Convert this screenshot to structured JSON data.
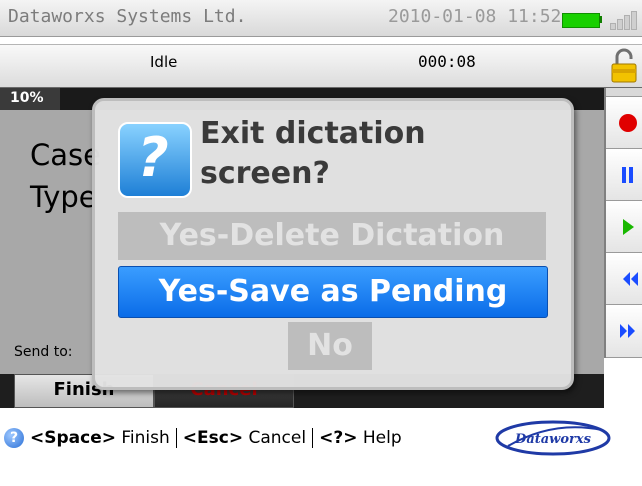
{
  "statusbar": {
    "company": "Dataworxs Systems Ltd.",
    "datetime": "2010-01-08 11:52",
    "colors": {
      "battery": "#19d000"
    }
  },
  "recorder": {
    "state": "Idle",
    "timer": "000:08",
    "progress_text": "10%",
    "progress_fraction": 0.1
  },
  "main": {
    "case_label": "Case",
    "type_label": "Type",
    "send_to_label": "Send to:"
  },
  "controls": [
    {
      "icon": "record-icon",
      "color": "#e00000"
    },
    {
      "icon": "pause-icon",
      "color": "#1a4cff"
    },
    {
      "icon": "play-icon",
      "color": "#19b800"
    },
    {
      "icon": "rewind-icon",
      "color": "#1a4cff"
    },
    {
      "icon": "fast-forward-icon",
      "color": "#1a4cff"
    }
  ],
  "tabs": {
    "finish": "Finish",
    "cancel": "Cancel"
  },
  "help": {
    "space_key": "<Space>",
    "finish": " Finish",
    "esc_key": "<Esc>",
    "cancel": " Cancel",
    "help_key": "<?>",
    "help": " Help",
    "logo_text": "Dataworxs"
  },
  "dialog": {
    "title_line1": "Exit dictation",
    "title_line2": "screen?",
    "btn_delete": "Yes-Delete Dictation",
    "btn_save": "Yes-Save as Pending",
    "btn_no": "No",
    "colors": {
      "selected": "#0a6ce8",
      "disabled": "#bdbdbd"
    }
  }
}
